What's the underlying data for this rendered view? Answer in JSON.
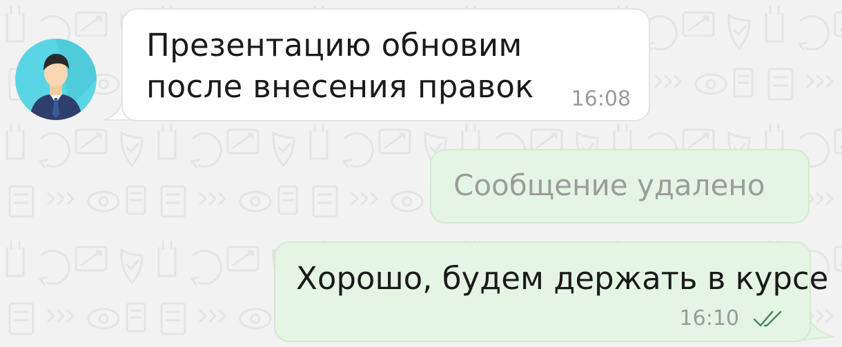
{
  "chat": {
    "messages": [
      {
        "direction": "incoming",
        "text": "Презентацию обновим после внесения правок",
        "time": "16:08",
        "avatar_icon": "businessman-avatar-icon"
      },
      {
        "direction": "outgoing",
        "deleted": true,
        "text": "Сообщение удалено"
      },
      {
        "direction": "outgoing",
        "text": "Хорошо, будем держать в курсе",
        "time": "16:10",
        "status_icon": "double-check-icon",
        "status": "read"
      }
    ]
  },
  "colors": {
    "background": "#f2f2f2",
    "incoming_bubble": "#ffffff",
    "outgoing_bubble": "#e5f5e4",
    "avatar_bg": "#5ad5e6",
    "read_tick": "#4a8a5c"
  }
}
